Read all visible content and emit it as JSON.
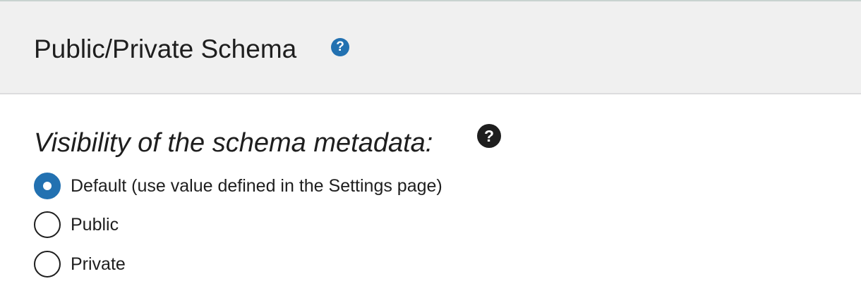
{
  "panel": {
    "title": "Public/Private Schema",
    "help_icon": "question-circle-icon"
  },
  "field": {
    "label": "Visibility of the schema metadata:",
    "help_icon": "question-circle-icon",
    "options": [
      {
        "label": "Default (use value defined in the Settings page)",
        "checked": true
      },
      {
        "label": "Public",
        "checked": false
      },
      {
        "label": "Private",
        "checked": false
      }
    ]
  },
  "colors": {
    "accent": "#2271b1",
    "header_bg": "#f0f0f0",
    "text": "#1e1e1e"
  }
}
